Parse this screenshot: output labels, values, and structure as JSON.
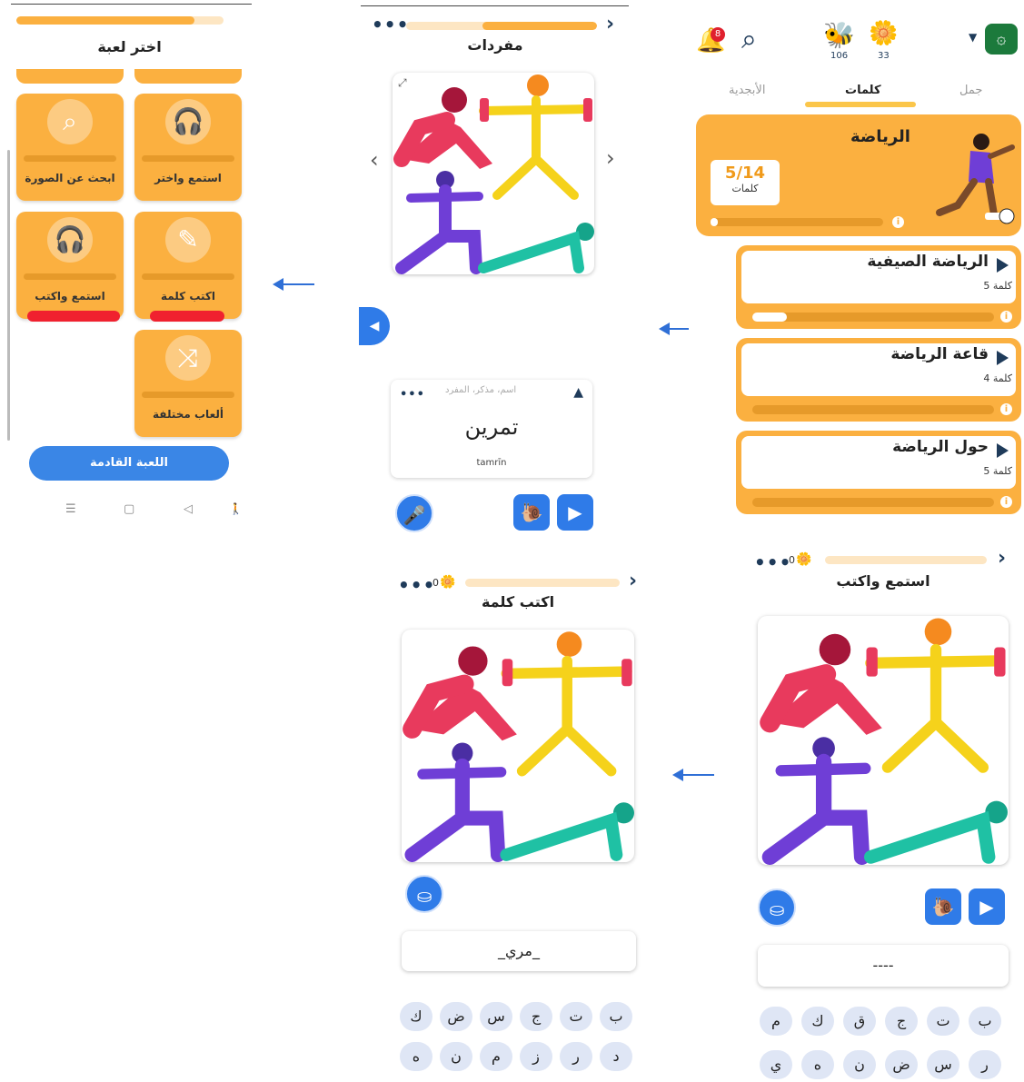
{
  "choose_game": {
    "title": "اختر لعبة",
    "tiles": [
      {
        "label": "استمع واختر",
        "icon": "headphones-icon"
      },
      {
        "label": "ابحث عن الصورة",
        "icon": "image-search-icon"
      },
      {
        "label": "اكتب كلمة",
        "icon": "pencil-note-icon"
      },
      {
        "label": "استمع واكتب",
        "icon": "headphones-icon"
      },
      {
        "label": "ألعاب مختلفة",
        "icon": "shuffle-icon"
      }
    ],
    "next_button": "اللعبة القادمة",
    "nav": {
      "menu": "☰",
      "home": "▢",
      "back": "◁",
      "accessibility": "🚶"
    }
  },
  "vocab": {
    "title": "مفردات",
    "card_meta": "اسم، مذكر، المفرد",
    "word": "تمرين",
    "transliteration": "tamrīn"
  },
  "home": {
    "notification_count": "8",
    "bee_count": "106",
    "flower_count": "33",
    "tabs": [
      "الأبجدية",
      "كلمات",
      "جمل"
    ],
    "active_tab": "كلمات",
    "hero_title": "الرياضة",
    "hero_progress": "5/14",
    "hero_progress_label": "كلمات",
    "topics": [
      {
        "name": "الرياضة الصيفية",
        "count": "5 كلمة",
        "progress": 0.15
      },
      {
        "name": "قاعة الرياضة",
        "count": "4 كلمة",
        "progress": 0
      },
      {
        "name": "حول الرياضة",
        "count": "5 كلمة",
        "progress": 0
      }
    ]
  },
  "write_word": {
    "title": "اكتب كلمة",
    "points": "0",
    "answer": "_مري_",
    "keys_row1": [
      "ب",
      "ت",
      "ج",
      "س",
      "ض",
      "ك"
    ],
    "keys_row2": [
      "د",
      "ر",
      "ز",
      "م",
      "ن",
      "ه"
    ]
  },
  "listen_write": {
    "title": "استمع واكتب",
    "points": "0",
    "answer": "----",
    "keys_row1": [
      "ب",
      "ت",
      "ج",
      "ق",
      "ك",
      "م"
    ],
    "keys_row2": [
      "ر",
      "س",
      "ض",
      "ن",
      "ه",
      "ي"
    ]
  },
  "colors": {
    "accent": "#fbb040",
    "blue": "#2f7be8",
    "red_mark": "#f0212f"
  }
}
